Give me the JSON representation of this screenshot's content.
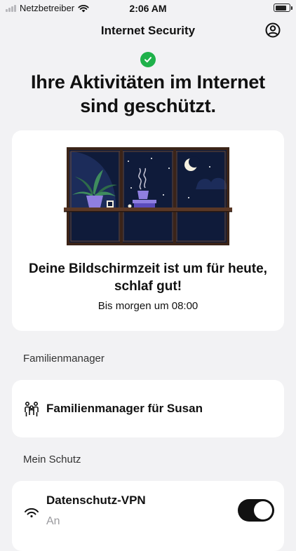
{
  "status_bar": {
    "carrier": "Netzbetreiber",
    "time": "2:06 AM"
  },
  "header": {
    "title": "Internet Security"
  },
  "headline": "Ihre Aktivitäten im Internet sind geschützt.",
  "hero": {
    "title": "Deine Bildschirmzeit ist um für heute, schlaf gut!",
    "subtitle": "Bis morgen um 08:00"
  },
  "sections": {
    "family": {
      "label": "Familienmanager",
      "item_label": "Familienmanager für Susan",
      "item_icon": "family-icon"
    },
    "protection": {
      "label": "Mein Schutz",
      "vpn_label": "Datenschutz-VPN",
      "vpn_status": "An",
      "vpn_icon": "wifi-shield-icon",
      "vpn_enabled": true
    }
  },
  "colors": {
    "background": "#f2f2f4",
    "card": "#ffffff",
    "success": "#1fb14a",
    "night_sky": "#0f1b3a",
    "window_frame": "#3b2418",
    "plant_pot": "#8f7fe0",
    "toggle_on": "#111111"
  }
}
